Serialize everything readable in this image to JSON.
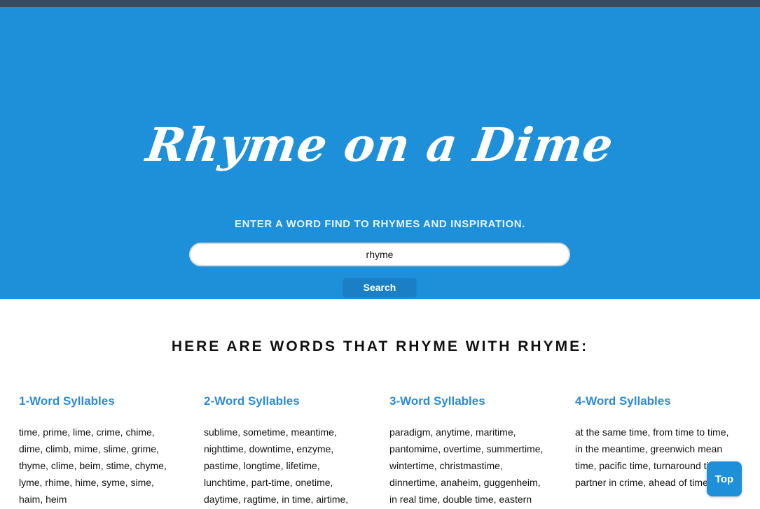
{
  "header": {
    "logo_text": "Rhyme on a Dime",
    "tagline": "ENTER A WORD FIND TO RHYMES AND INSPIRATION.",
    "search_value": "rhyme",
    "search_button": "Search"
  },
  "results": {
    "title": "HERE ARE WORDS THAT RHYME WITH RHYME:",
    "columns": [
      {
        "heading": "1-Word Syllables",
        "words": "time, prime, lime, crime, chime, dime, climb, mime, slime, grime, thyme, clime, beim, stime, chyme, lyme, rhime, hime, syme, sime, haim, heim"
      },
      {
        "heading": "2-Word Syllables",
        "words": "sublime, sometime, meantime, nighttime, downtime, enzyme, pastime, longtime, lifetime, lunchtime, part-time, onetime, daytime, ragtime, in time, airtime,"
      },
      {
        "heading": "3-Word Syllables",
        "words": "paradigm, anytime, maritime, pantomime, overtime, summertime, wintertime, christmastime, dinnertime, anaheim, guggenheim, in real time, double time, eastern"
      },
      {
        "heading": "4-Word Syllables",
        "words": "at the same time, from time to time, in the meantime, greenwich mean time, pacific time, turnaround time, partner in crime, ahead of time"
      }
    ]
  },
  "scroll_top": {
    "label": "Top"
  },
  "colors": {
    "hero_background": "#1e8fd9",
    "topbar": "#3a4a5c",
    "heading_blue": "#2b8bd3",
    "button_blue": "#1a7fc4"
  }
}
